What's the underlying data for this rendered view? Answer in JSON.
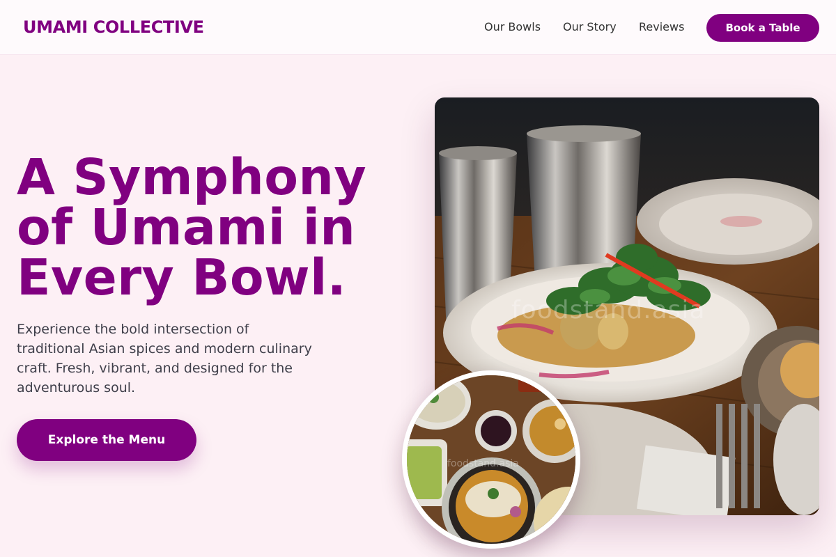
{
  "brand": {
    "name": "UMAMI COLLECTIVE"
  },
  "nav": {
    "links": [
      {
        "label": "Our Bowls"
      },
      {
        "label": "Our Story"
      },
      {
        "label": "Reviews"
      }
    ],
    "cta_label": "Book a Table"
  },
  "hero": {
    "headline_lines": [
      "A Symphony",
      "of Umami in",
      "Every Bowl."
    ],
    "description_lines": [
      "Experience the bold intersection of",
      "traditional Asian spices and modern culinary",
      "craft. Fresh, vibrant, and designed for the",
      "adventurous soul."
    ],
    "cta_label": "Explore the Menu"
  },
  "images": {
    "main_watermark": "foodstand.asia",
    "secondary_watermark": "foodstand.asia"
  },
  "colors": {
    "brand": "#800080",
    "page_background": "#fdf0f5",
    "header_background": "#fefafc"
  },
  "icons": {
    "main_photo": "plated-salad-photo",
    "secondary_photo": "bowls-spread-photo"
  }
}
